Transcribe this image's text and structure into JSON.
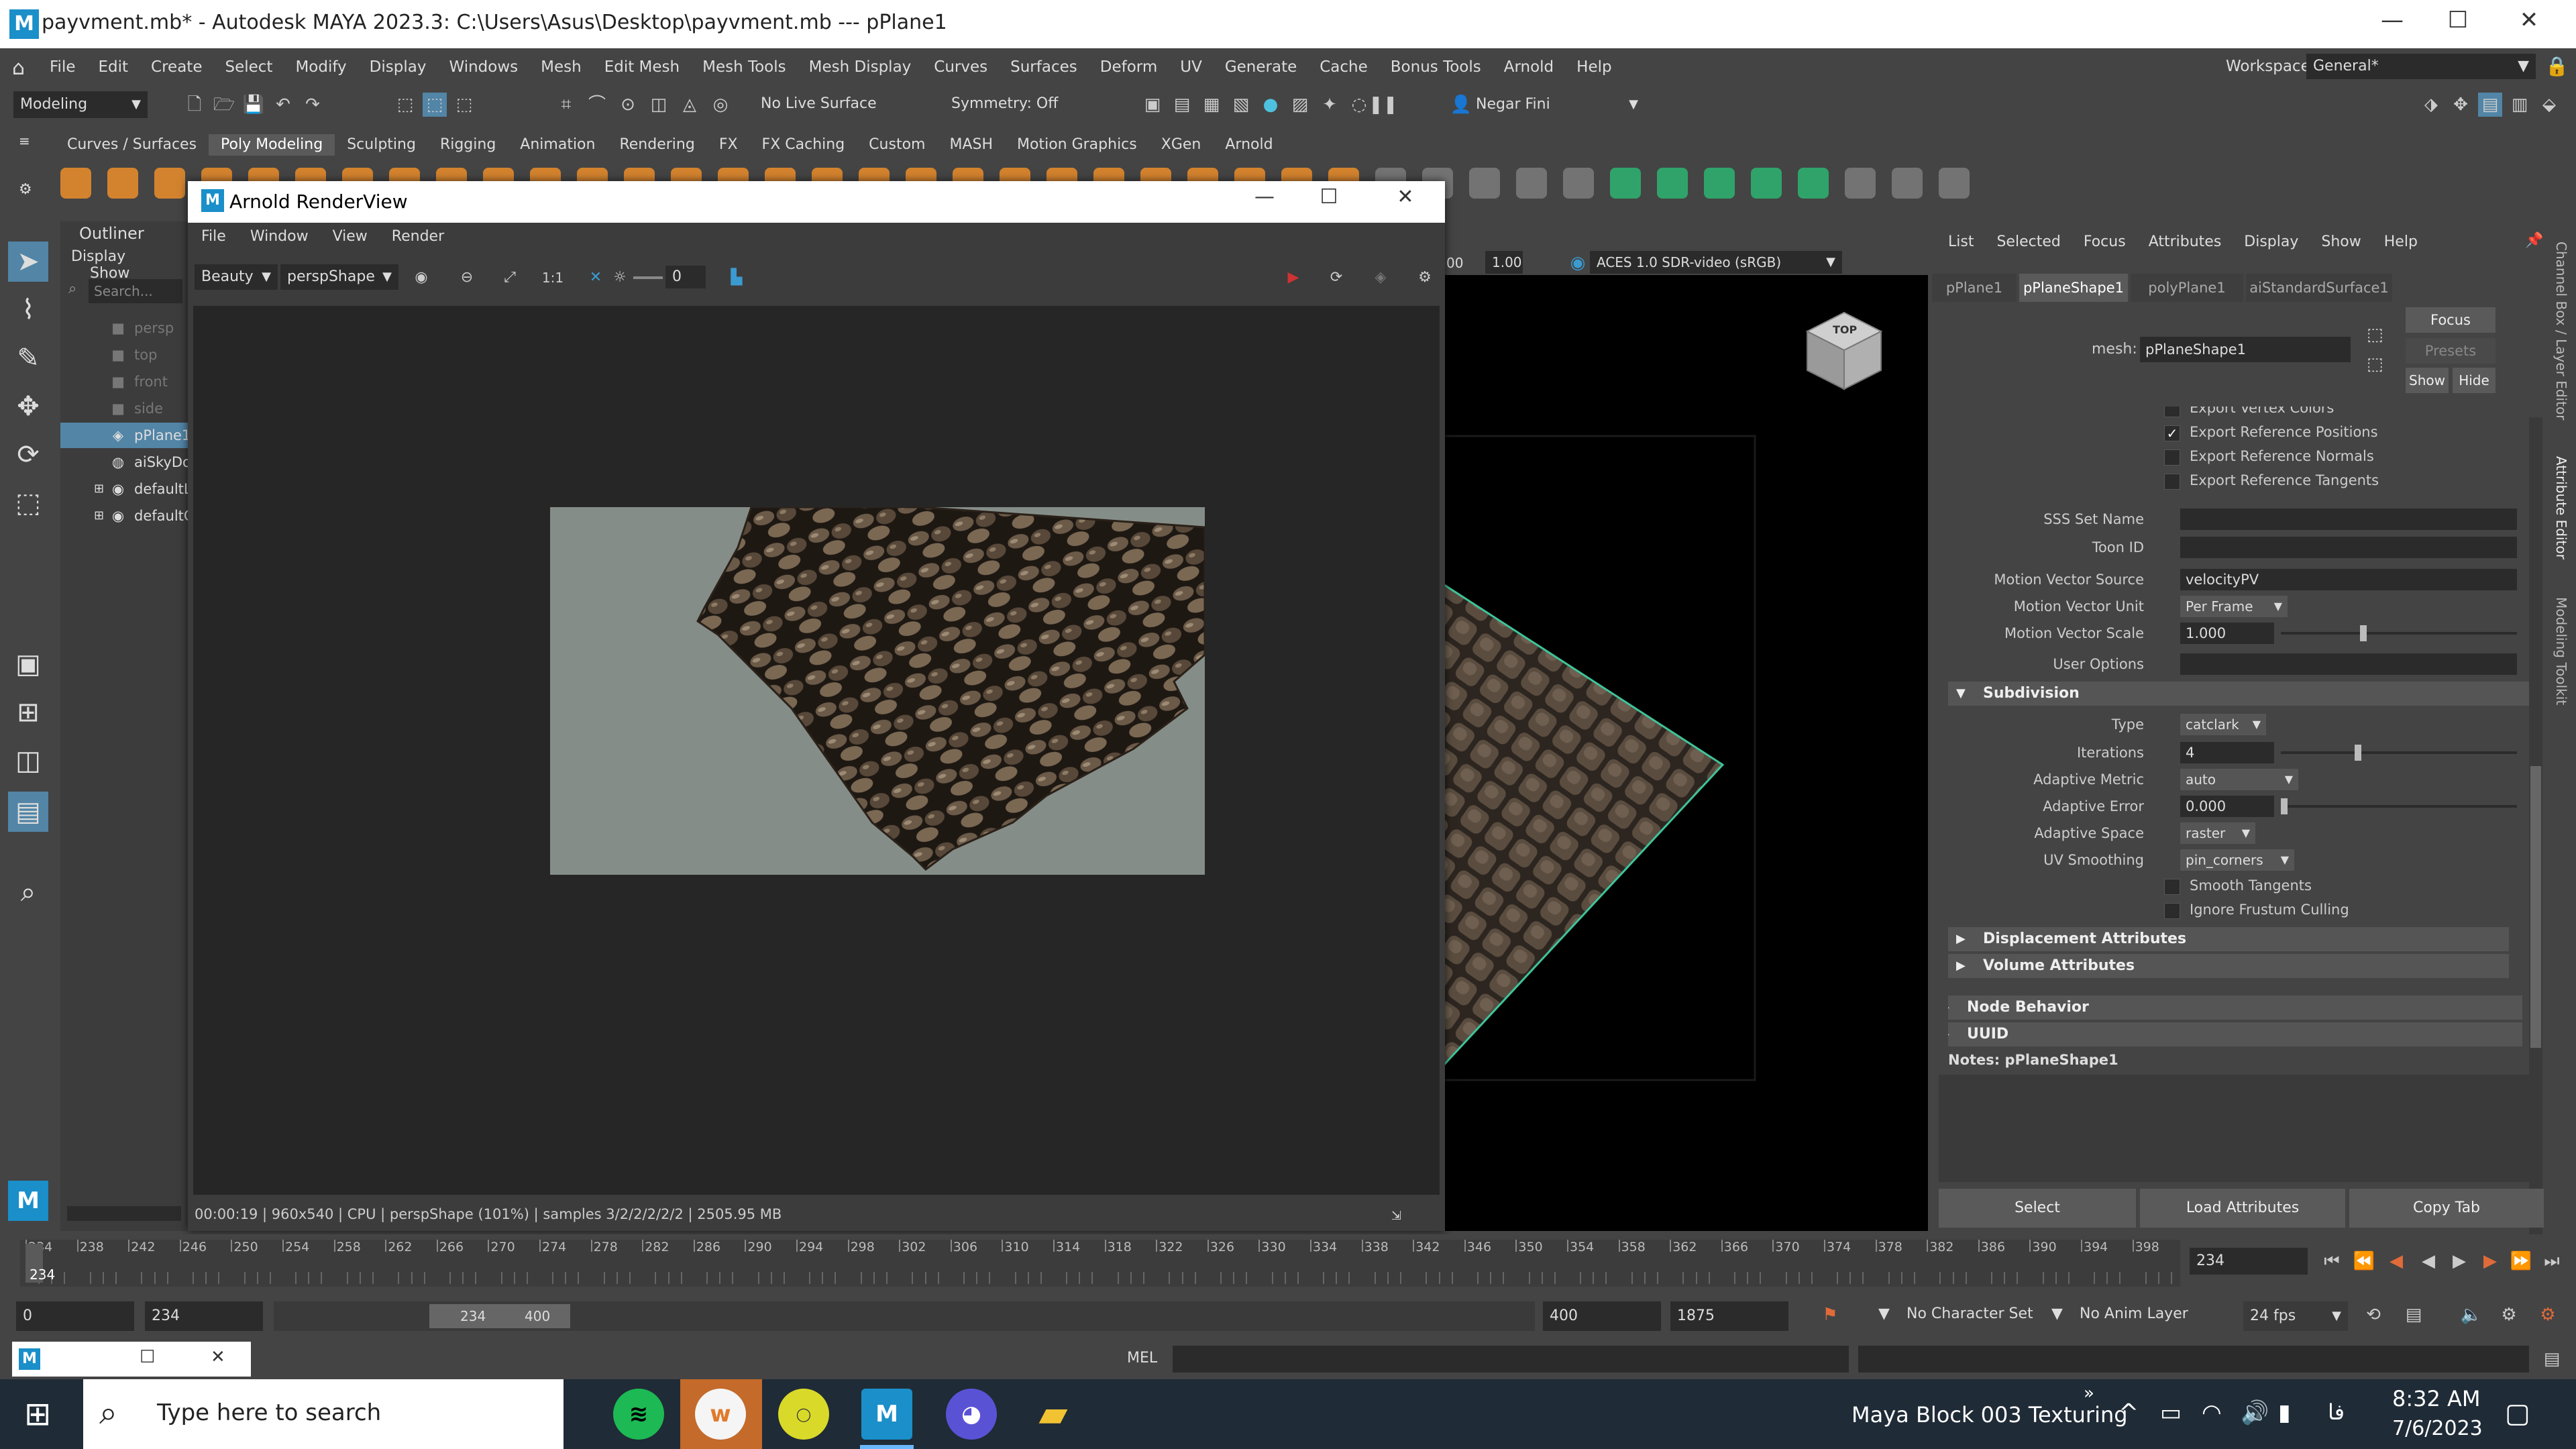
{
  "window": {
    "icon_letter": "M",
    "title": "payvment.mb* - Autodesk MAYA 2023.3: C:\\Users\\Asus\\Desktop\\payvment.mb  ---  pPlane1",
    "minimize": "—",
    "maximize": "☐",
    "close": "✕"
  },
  "menubar": {
    "items": [
      "File",
      "Edit",
      "Create",
      "Select",
      "Modify",
      "Display",
      "Windows",
      "Mesh",
      "Edit Mesh",
      "Mesh Tools",
      "Mesh Display",
      "Curves",
      "Surfaces",
      "Deform",
      "UV",
      "Generate",
      "Cache",
      "Bonus Tools",
      "Arnold",
      "Help"
    ],
    "workspace_label": "Workspace:",
    "workspace_value": "General*"
  },
  "statusline": {
    "mode": "Modeling",
    "live_surface": "No Live Surface",
    "symmetry": "Symmetry: Off",
    "user": "Negar Fini"
  },
  "shelf": {
    "tabs": [
      "Curves / Surfaces",
      "Poly Modeling",
      "Sculpting",
      "Rigging",
      "Animation",
      "Rendering",
      "FX",
      "FX Caching",
      "Custom",
      "MASH",
      "Motion Graphics",
      "XGen",
      "Arnold"
    ],
    "active_tab": "Poly Modeling"
  },
  "outliner": {
    "title": "Outliner",
    "menu_display": "Display",
    "menu_show": "Show",
    "search_placeholder": "Search...",
    "items": [
      {
        "label": "persp",
        "icon": "camera-icon",
        "selected": false,
        "dim": true
      },
      {
        "label": "top",
        "icon": "camera-icon",
        "selected": false,
        "dim": true
      },
      {
        "label": "front",
        "icon": "camera-icon",
        "selected": false,
        "dim": true
      },
      {
        "label": "side",
        "icon": "camera-icon",
        "selected": false,
        "dim": true
      },
      {
        "label": "pPlane1",
        "icon": "mesh-icon",
        "selected": true,
        "dim": false
      },
      {
        "label": "aiSkyDo",
        "icon": "skydome-icon",
        "selected": false,
        "dim": false
      },
      {
        "label": "defaultL",
        "icon": "set-icon",
        "selected": false,
        "dim": false
      },
      {
        "label": "defaultC",
        "icon": "set-icon",
        "selected": false,
        "dim": false
      }
    ]
  },
  "renderview": {
    "title": "Arnold RenderView",
    "menu": [
      "File",
      "Window",
      "View",
      "Render"
    ],
    "aov": "Beauty",
    "camera": "perspShape",
    "exposure": "0",
    "status": "00:00:19 | 960x540 | CPU | perspShape (101%) | samples 3/2/2/2/2/2 | 2505.95 MB"
  },
  "viewport": {
    "gamma": "1.00",
    "value_prefix": "00",
    "colorspace": "ACES 1.0 SDR-video (sRGB)",
    "viewcube_label": "TOP"
  },
  "attribute_editor": {
    "menu": [
      "List",
      "Selected",
      "Focus",
      "Attributes",
      "Display",
      "Show",
      "Help"
    ],
    "tabs": [
      "pPlane1",
      "pPlaneShape1",
      "polyPlane1",
      "aiStandardSurface1"
    ],
    "active_tab": "pPlaneShape1",
    "mesh_label": "mesh:",
    "mesh_value": "pPlaneShape1",
    "focus_btn": "Focus",
    "presets_btn": "Presets",
    "show_btn": "Show",
    "hide_btn": "Hide",
    "checkboxes_top": [
      {
        "label": "Export Vertex Colors",
        "checked": false
      },
      {
        "label": "Export Reference Positions",
        "checked": true
      },
      {
        "label": "Export Reference Normals",
        "checked": false
      },
      {
        "label": "Export Reference Tangents",
        "checked": false
      }
    ],
    "sss_set_name_label": "SSS Set Name",
    "toon_id_label": "Toon ID",
    "motion_vector_source_label": "Motion Vector Source",
    "motion_vector_source": "velocityPV",
    "motion_vector_unit_label": "Motion Vector Unit",
    "motion_vector_unit": "Per Frame",
    "motion_vector_scale_label": "Motion Vector Scale",
    "motion_vector_scale": "1.000",
    "user_options_label": "User Options",
    "subdivision_section": "Subdivision",
    "type_label": "Type",
    "type_value": "catclark",
    "iterations_label": "Iterations",
    "iterations_value": "4",
    "adaptive_metric_label": "Adaptive Metric",
    "adaptive_metric": "auto",
    "adaptive_error_label": "Adaptive Error",
    "adaptive_error": "0.000",
    "adaptive_space_label": "Adaptive Space",
    "adaptive_space": "raster",
    "uv_smoothing_label": "UV Smoothing",
    "uv_smoothing": "pin_corners",
    "checkboxes_sub": [
      {
        "label": "Smooth Tangents",
        "checked": false
      },
      {
        "label": "Ignore Frustum Culling",
        "checked": false
      }
    ],
    "sections_collapsed": [
      "Displacement Attributes",
      "Volume Attributes"
    ],
    "sections_outer": [
      "Node Behavior",
      "UUID"
    ],
    "notes_label": "Notes:  pPlaneShape1",
    "bottom_buttons": [
      "Select",
      "Load Attributes",
      "Copy Tab"
    ],
    "side_tabs": [
      "Channel Box / Layer Editor",
      "Attribute Editor",
      "Modeling Toolkit"
    ]
  },
  "timeline": {
    "ticks": [
      "234",
      "238",
      "242",
      "246",
      "250",
      "254",
      "258",
      "262",
      "266",
      "270",
      "274",
      "278",
      "282",
      "286",
      "290",
      "294",
      "298",
      "302",
      "306",
      "310",
      "314",
      "318",
      "322",
      "326",
      "330",
      "334",
      "338",
      "342",
      "346",
      "350",
      "354",
      "358",
      "362",
      "366",
      "370",
      "374",
      "378",
      "382",
      "386",
      "390",
      "394",
      "398"
    ],
    "current_marker": "234",
    "current_frame": "234"
  },
  "range": {
    "start": "0",
    "playback_start": "234",
    "slider_start": "234",
    "slider_end": "400",
    "playback_end": "400",
    "end": "1875",
    "character_set": "No Character Set",
    "anim_layer": "No Anim Layer",
    "fps": "24 fps"
  },
  "cmdline": {
    "lang": "MEL"
  },
  "taskbar": {
    "search_placeholder": "Type here to search",
    "active_window": "Maya Block 003 Texturing",
    "time": "8:32 AM",
    "date": "7/6/2023",
    "lang": "فا"
  },
  "colors": {
    "maya_blue": "#1a8fc9",
    "selection": "#5285a6",
    "panel": "#444444",
    "field": "#2b2b2b"
  }
}
